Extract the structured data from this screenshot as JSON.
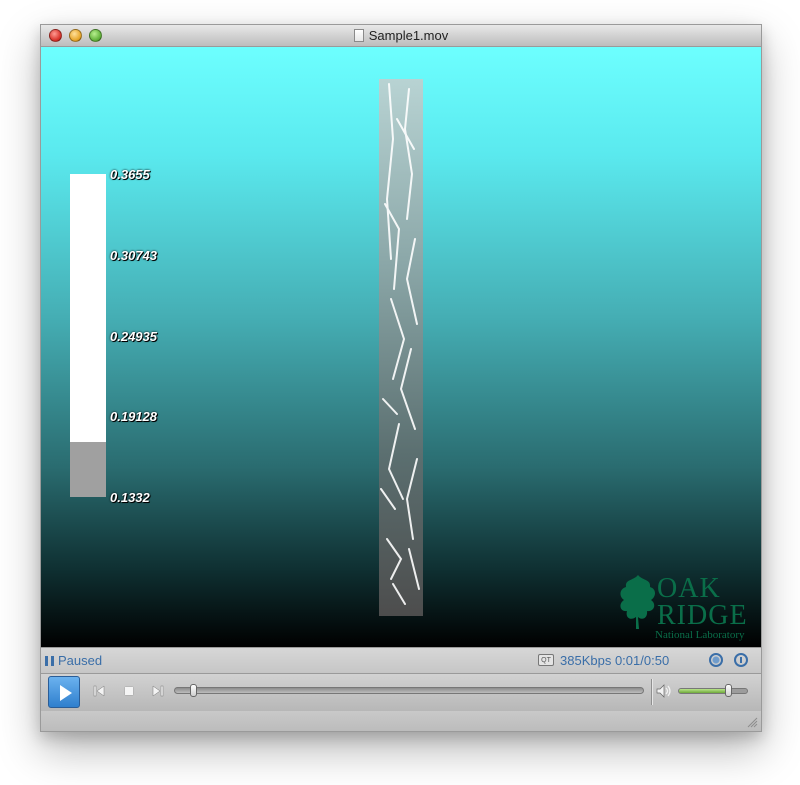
{
  "window": {
    "title": "Sample1.mov"
  },
  "icons": {
    "close": "close-icon",
    "minimize": "minimize-icon",
    "zoom": "zoom-icon",
    "document": "document-icon",
    "pause": "pause-icon",
    "quicktime": "qt-icon",
    "globe": "globe-icon",
    "share": "pin-icon",
    "play": "play-icon",
    "previous": "skip-back-icon",
    "stop": "stop-icon",
    "next": "skip-forward-icon",
    "volume": "speaker-icon",
    "resize": "resize-grip-icon"
  },
  "video_overlay": {
    "colorbar_ticks": [
      "0.3655",
      "0.30743",
      "0.24935",
      "0.19128",
      "0.1332"
    ],
    "colorbar_level": 0.17,
    "logo": {
      "line1": "OAK",
      "line2": "RIDGE",
      "line3": "National Laboratory"
    }
  },
  "status": {
    "state": "Paused",
    "qt_badge": "QT",
    "bitrate": "385Kbps",
    "time": "0:01/0:50"
  },
  "controls": {
    "playback_position": 0.04,
    "volume_level": 0.73
  },
  "colors": {
    "video_top": "#6dffff",
    "video_bottom": "#000000",
    "status_text": "#3a6ea8",
    "logo_green": "#0a6e49",
    "play_button": "#2f7fcd"
  }
}
